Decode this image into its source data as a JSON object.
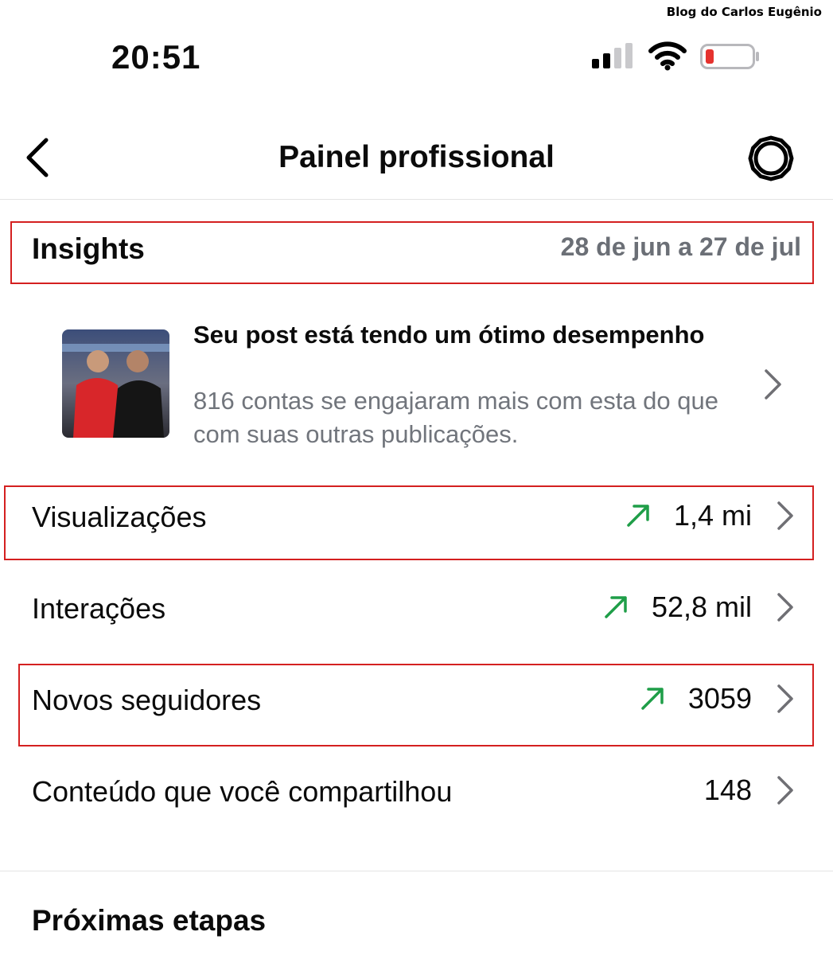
{
  "watermark": "Blog do Carlos Eugênio",
  "status_bar": {
    "time": "20:51",
    "icons": [
      "cellular-signal-icon",
      "wifi-icon",
      "battery-low-icon"
    ],
    "battery_color": "#e5322e"
  },
  "header": {
    "title": "Painel profissional",
    "back_icon": "chevron-left-icon",
    "settings_icon": "gear-icon"
  },
  "insights": {
    "title": "Insights",
    "date_range": "28 de jun a 27 de jul"
  },
  "post_card": {
    "title": "Seu post está tendo um ótimo desempenho",
    "description": "816 contas se engajaram mais com esta do que com suas outras publicações."
  },
  "metrics": [
    {
      "label": "Visualizações",
      "value": "1,4 mi",
      "trend": "up"
    },
    {
      "label": "Interações",
      "value": "52,8 mil",
      "trend": "up"
    },
    {
      "label": "Novos seguidores",
      "value": "3059",
      "trend": "up"
    },
    {
      "label": "Conteúdo que você compartilhou",
      "value": "148",
      "trend": "none"
    }
  ],
  "next_steps": {
    "title": "Próximas etapas"
  },
  "colors": {
    "trend_up": "#1f9e48",
    "highlight_box": "#d42020",
    "secondary_text": "#6b6f76"
  }
}
